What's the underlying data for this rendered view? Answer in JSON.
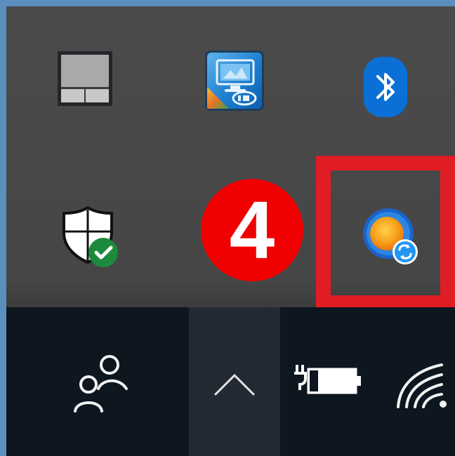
{
  "annotation": {
    "step_number": "4",
    "badge_color": "#f00000",
    "highlight_color": "#e01d25"
  },
  "tray_flyout": {
    "background": "#474747",
    "icons": [
      {
        "name": "touchpad-icon"
      },
      {
        "name": "intel-graphics-icon"
      },
      {
        "name": "bluetooth-icon",
        "color": "#0a6fd6"
      },
      {
        "name": "windows-security-icon",
        "status": "ok"
      },
      {
        "name": "sync-app-icon",
        "highlighted": true
      }
    ]
  },
  "taskbar": {
    "background": "#0e1620",
    "items": [
      {
        "name": "people-icon"
      },
      {
        "name": "show-hidden-icons-chevron-icon",
        "expanded": true
      },
      {
        "name": "battery-charging-icon",
        "charging": true
      },
      {
        "name": "wifi-icon"
      }
    ]
  }
}
